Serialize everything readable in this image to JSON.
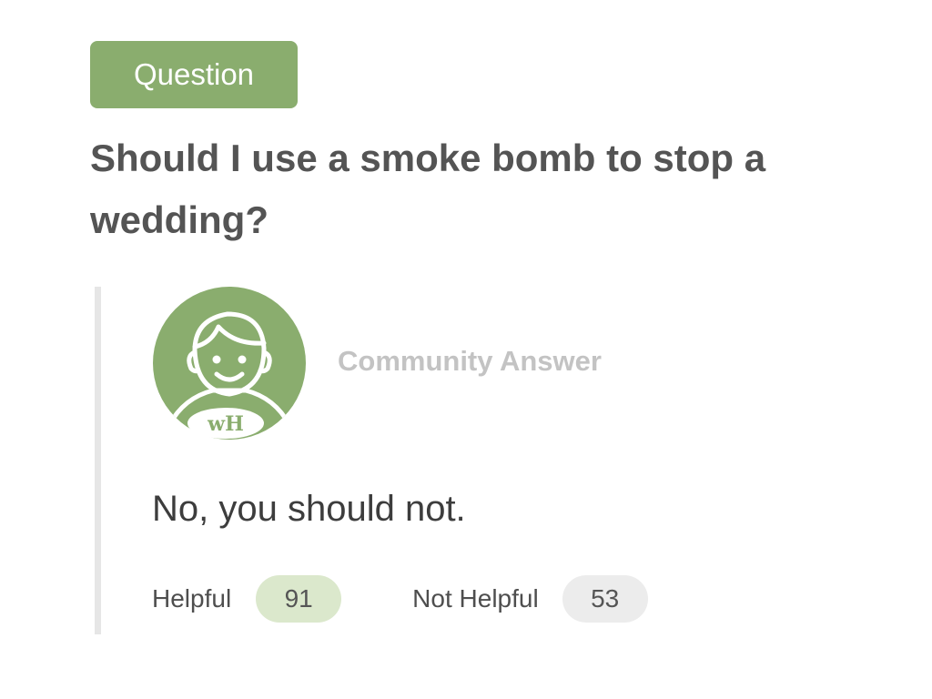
{
  "question": {
    "badge_label": "Question",
    "title": "Should I use a smoke bomb to stop a wedding?"
  },
  "answer": {
    "avatar_icon": "user-avatar-icon",
    "avatar_monogram": "wH",
    "author_label": "Community Answer",
    "text": "No, you should not.",
    "votes": {
      "helpful_label": "Helpful",
      "helpful_count": "91",
      "not_helpful_label": "Not Helpful",
      "not_helpful_count": "53"
    }
  },
  "colors": {
    "accent_green": "#8aad6e",
    "helpful_pill": "#dbe8cc",
    "not_helpful_pill": "#ececec"
  }
}
